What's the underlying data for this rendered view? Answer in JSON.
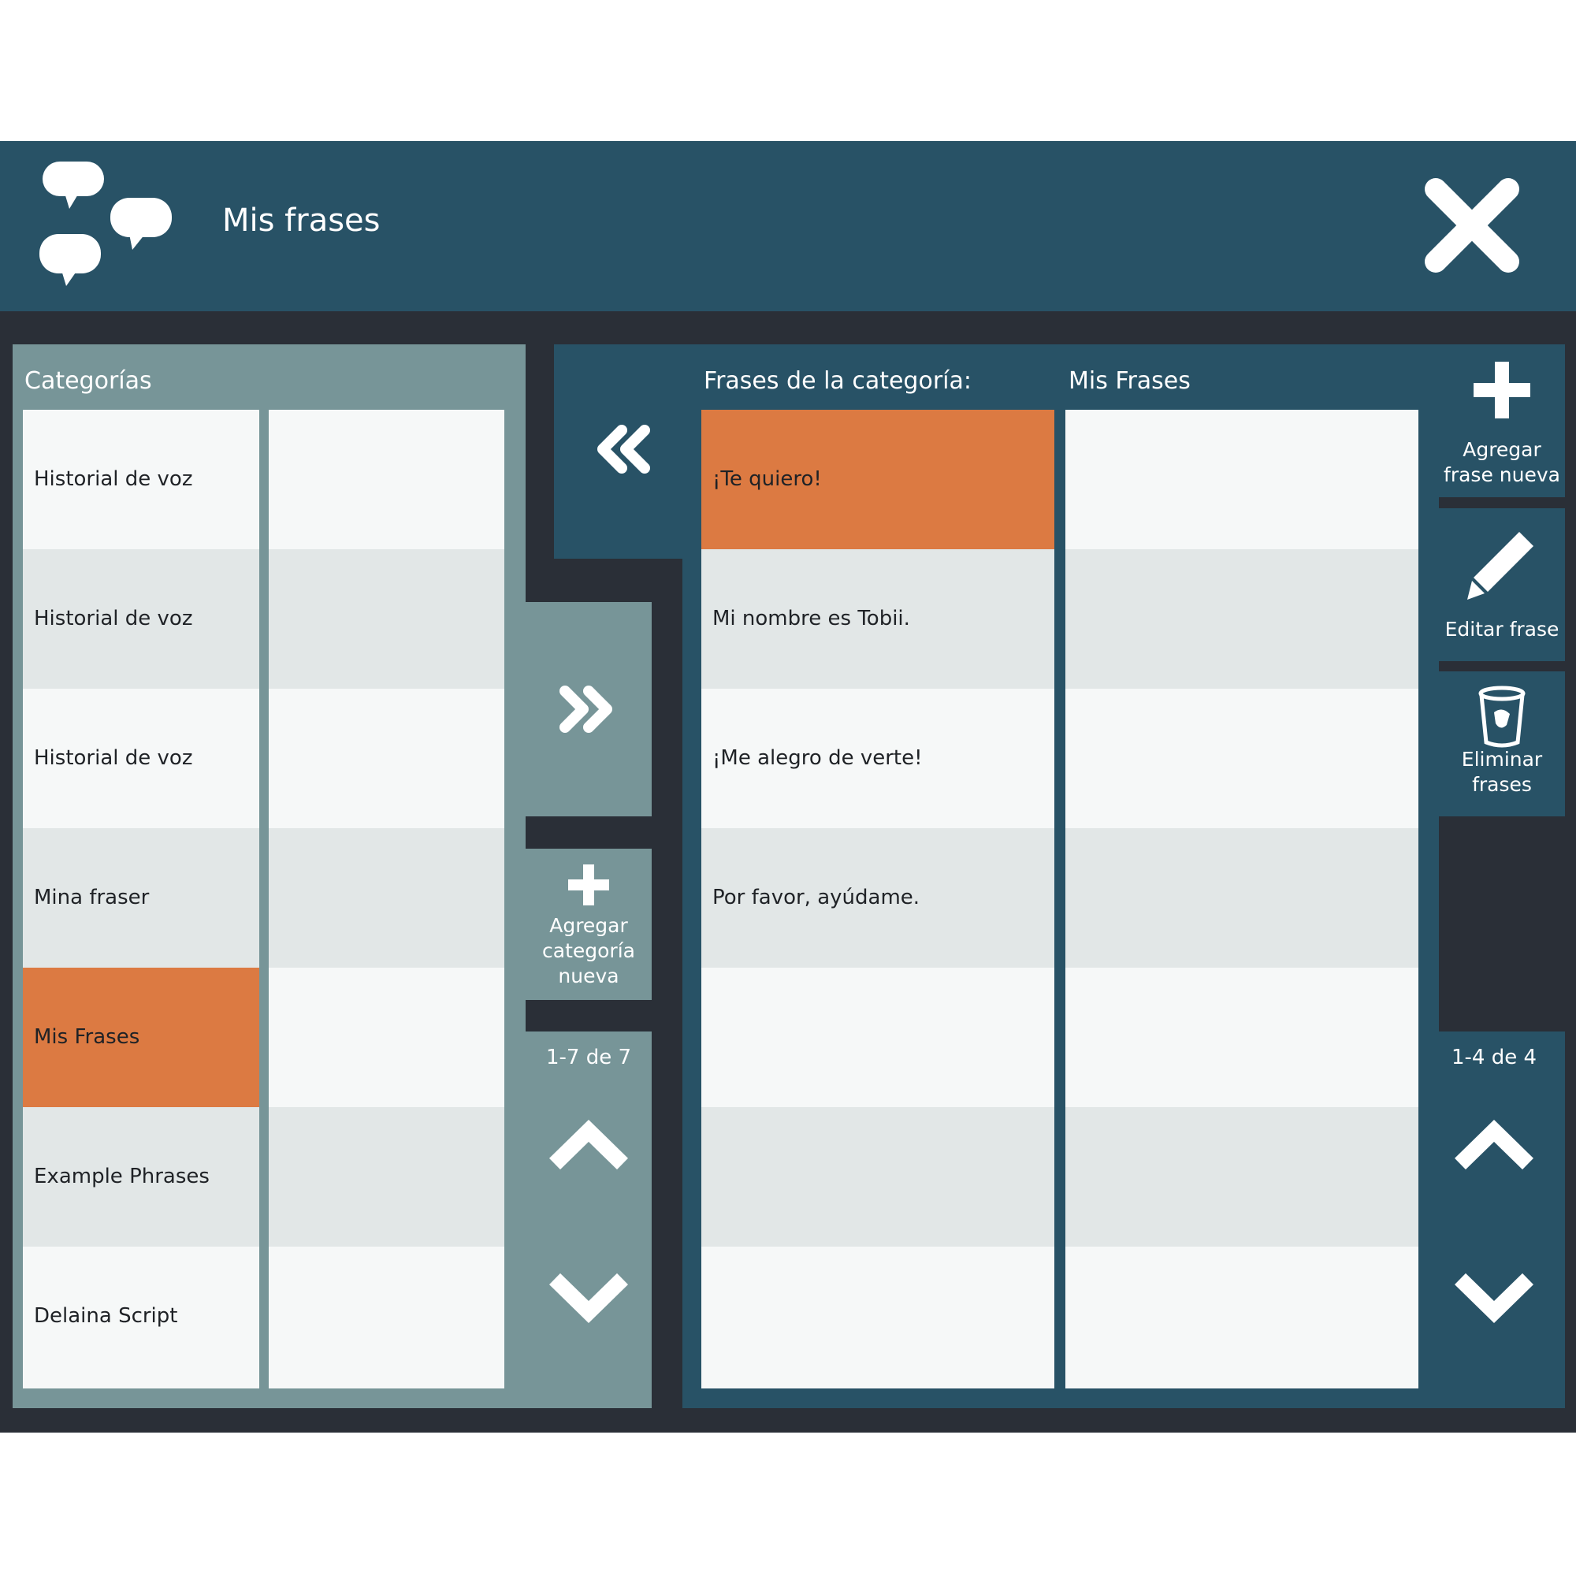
{
  "header": {
    "title": "Mis frases"
  },
  "categories": {
    "title": "Categorías",
    "items": [
      {
        "label": "Historial de voz",
        "selected": false
      },
      {
        "label": "Historial de voz",
        "selected": false
      },
      {
        "label": "Historial de voz",
        "selected": false
      },
      {
        "label": "Mina fraser",
        "selected": false
      },
      {
        "label": "Mis Frases",
        "selected": true
      },
      {
        "label": "Example Phrases",
        "selected": false
      },
      {
        "label": "Delaina Script",
        "selected": false
      }
    ],
    "add_label": "Agregar categoría nueva",
    "counter": "1-7 de 7"
  },
  "phrases": {
    "title": "Frases de la categoría:",
    "category": "Mis Frases",
    "items": [
      {
        "label": "¡Te quiero!",
        "selected": true
      },
      {
        "label": "Mi nombre es Tobii.",
        "selected": false
      },
      {
        "label": "¡Me alegro de verte!",
        "selected": false
      },
      {
        "label": "Por favor, ayúdame.",
        "selected": false
      }
    ],
    "counter": "1-4 de 4"
  },
  "actions": {
    "add_phrase": "Agregar frase nueva",
    "edit_phrase": "Editar frase",
    "delete_phrases": "Eliminar frases"
  },
  "icons": {
    "logo": "speech-bubbles-icon",
    "close": "close-icon",
    "forward": "double-chevron-right-icon",
    "back": "double-chevron-left-icon",
    "add": "plus-icon",
    "edit": "pencil-icon",
    "delete": "trash-bin-icon",
    "up": "chevron-up-icon",
    "down": "chevron-down-icon"
  },
  "colors": {
    "header": "#285266",
    "window": "#2a2f37",
    "categories_panel": "#779598",
    "selection": "#dc7a42",
    "row_light": "#f6f8f8",
    "row_alt": "#e2e7e7"
  }
}
